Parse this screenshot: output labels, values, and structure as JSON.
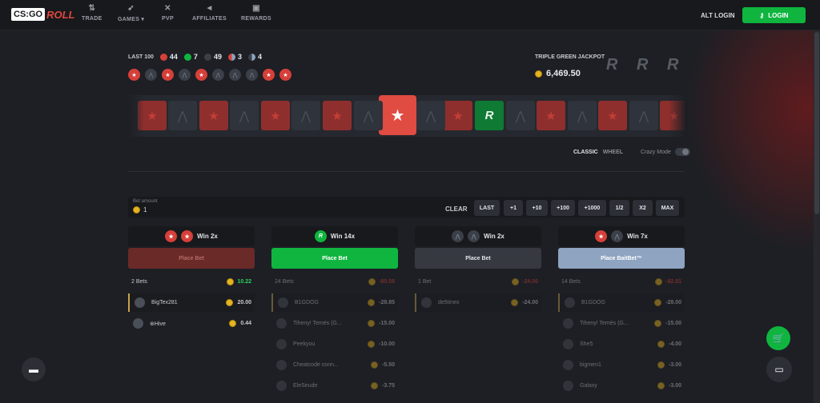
{
  "nav": {
    "items": [
      {
        "label": "TRADE",
        "icon": "trade-arrows-icon"
      },
      {
        "label": "GAMES",
        "icon": "rocket-icon",
        "caret": "▾"
      },
      {
        "label": "PVP",
        "icon": "swords-icon"
      },
      {
        "label": "AFFILIATES",
        "icon": "megaphone-icon"
      },
      {
        "label": "REWARDS",
        "icon": "gift-icon"
      }
    ],
    "alt_login": "ALT LOGIN",
    "login": "LOGIN"
  },
  "logo": {
    "cs": "CS:GO",
    "roll": "ROLL"
  },
  "last100": {
    "label": "LAST 100",
    "stats": [
      {
        "value": "44",
        "color": "#d6403a"
      },
      {
        "value": "7",
        "color": "#0fb53f"
      },
      {
        "value": "49",
        "color": "#3a3f48"
      },
      {
        "value": "3",
        "color": "#d6403a"
      },
      {
        "value": "4",
        "color": "#8a8e98"
      }
    ],
    "history": [
      "t",
      "ct",
      "t",
      "ct",
      "t",
      "ct",
      "ct",
      "ct",
      "t",
      "t"
    ]
  },
  "jackpot": {
    "label": "TRIPLE GREEN JACKPOT",
    "value": "6,469.50",
    "logos": [
      "R",
      "R",
      "R"
    ]
  },
  "reel": [
    "t",
    "ct",
    "t",
    "ct",
    "t",
    "ct",
    "t",
    "ct",
    "center",
    "ct",
    "t",
    "g",
    "ct",
    "t",
    "ct",
    "t",
    "ct",
    "t"
  ],
  "modes": {
    "classic": "CLASSIC",
    "wheel": "WHEEL",
    "crazy": "Crazy Mode"
  },
  "bet": {
    "label": "Bet amount",
    "amount": "1",
    "clear": "CLEAR",
    "buttons": [
      "LAST",
      "+1",
      "+10",
      "+100",
      "+1000",
      "1/2",
      "X2",
      "MAX"
    ]
  },
  "columns": [
    {
      "title": "Win 2x",
      "icons": [
        "t",
        "t"
      ],
      "button": "Place Bet",
      "button_bg": "#6a2a28",
      "button_fg": "#b56a66",
      "count": "2 Bets",
      "total": "10.22",
      "total_color": "#2ed35f",
      "rows": [
        {
          "name": "BigTex281",
          "value": "20.00",
          "hl": true
        },
        {
          "name": "⊛Hive",
          "value": "0.44",
          "hl": false
        }
      ]
    },
    {
      "title": "Win 14x",
      "icons": [
        "g"
      ],
      "button": "Place Bet",
      "button_bg": "#0fb53f",
      "button_fg": "#ffffff",
      "count": "24 Bets",
      "total": "-80.58",
      "total_color": "#d6403a",
      "dim": true,
      "rows": [
        {
          "name": "B1GDOG",
          "value": "-28.85",
          "hl": true
        },
        {
          "name": "Tiheny! Temés (G...",
          "value": "-15.00",
          "hl": false
        },
        {
          "name": "Peekyou",
          "value": "-10.00",
          "hl": false
        },
        {
          "name": "Cheatcode conn...",
          "value": "-5.50",
          "hl": false
        },
        {
          "name": "EleSeude",
          "value": "-3.75",
          "hl": false
        }
      ]
    },
    {
      "title": "Win 2x",
      "icons": [
        "ct",
        "ct"
      ],
      "button": "Place Bet",
      "button_bg": "#363940",
      "button_fg": "#e3e5ea",
      "count": "1 Bet",
      "total": "-24.00",
      "total_color": "#d6403a",
      "dim": true,
      "rows": [
        {
          "name": "de5tinex",
          "value": "-24.00",
          "hl": true
        }
      ]
    },
    {
      "title": "Win 7x",
      "icons": [
        "t",
        "ct"
      ],
      "button": "Place BaitBet™",
      "button_bg": "#8ea4c0",
      "button_fg": "#ffffff",
      "count": "14 Bets",
      "total": "-82.81",
      "total_color": "#d6403a",
      "dim": true,
      "rows": [
        {
          "name": "B1GDOG",
          "value": "-28.00",
          "hl": true
        },
        {
          "name": "Tiheny! Temés (G...",
          "value": "-15.00",
          "hl": false
        },
        {
          "name": "She5",
          "value": "-4.00",
          "hl": false
        },
        {
          "name": "bigmen1",
          "value": "-3.00",
          "hl": false
        },
        {
          "name": "Galaxy",
          "value": "-3.00",
          "hl": false
        }
      ]
    }
  ]
}
